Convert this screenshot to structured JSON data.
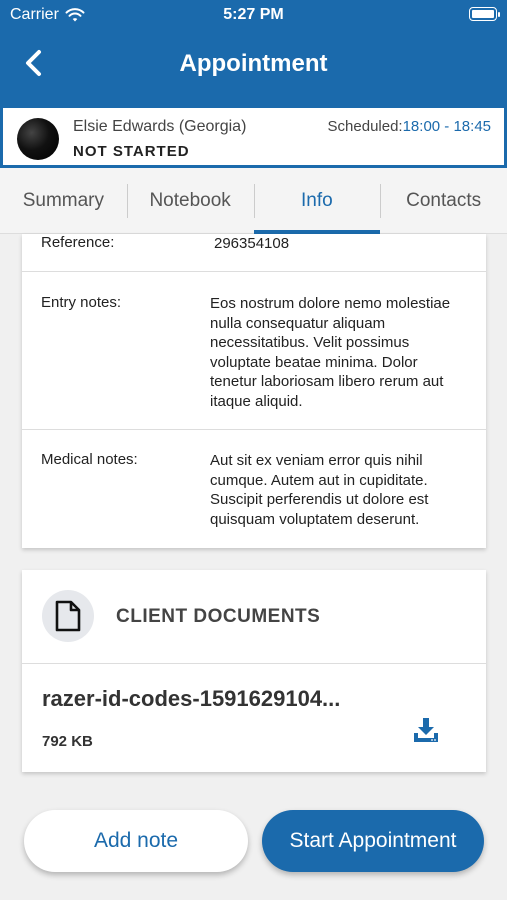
{
  "status_bar": {
    "carrier": "Carrier",
    "time": "5:27 PM"
  },
  "header": {
    "title": "Appointment",
    "back_icon": "chevron-left-icon"
  },
  "client": {
    "name": "Elsie Edwards (Georgia)",
    "status": "NOT STARTED",
    "scheduled_label": "Scheduled:",
    "scheduled_time": "18:00 - 18:45"
  },
  "tabs": [
    {
      "label": "Summary",
      "active": false
    },
    {
      "label": "Notebook",
      "active": false
    },
    {
      "label": "Info",
      "active": true
    },
    {
      "label": "Contacts",
      "active": false
    }
  ],
  "info": {
    "reference_label": "Reference:",
    "reference_value": "296354108",
    "entry_notes_label": "Entry notes:",
    "entry_notes_value": "Eos nostrum dolore nemo molestiae nulla consequatur aliquam necessitatibus. Velit possimus voluptate beatae minima. Dolor tenetur laboriosam libero rerum aut itaque aliquid.",
    "medical_notes_label": "Medical notes:",
    "medical_notes_value": "Aut sit ex veniam error quis nihil cumque. Autem aut in cupiditate. Suscipit perferendis ut dolore est quisquam voluptatem deserunt."
  },
  "documents": {
    "title": "CLIENT DOCUMENTS",
    "file_name": "razer-id-codes-1591629104...",
    "file_size": "792 KB",
    "icon": "document-icon",
    "download_icon": "download-icon"
  },
  "actions": {
    "add_note": "Add note",
    "start": "Start Appointment"
  },
  "colors": {
    "primary": "#1b6aac"
  }
}
